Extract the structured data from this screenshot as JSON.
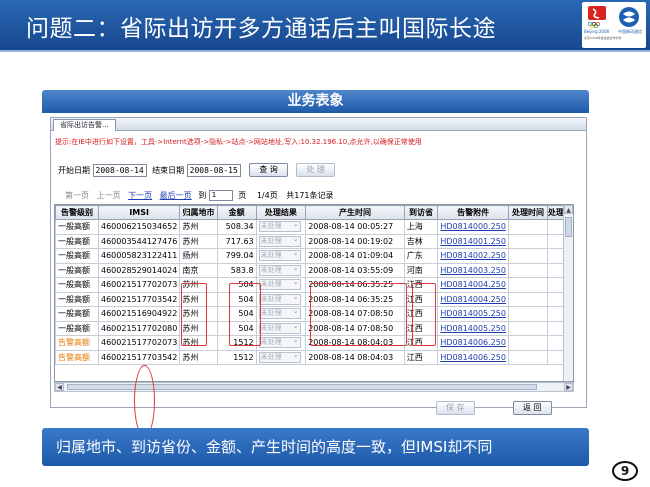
{
  "slide": {
    "title": "问题二：省际出访开多方通话后主叫国际长途",
    "caption": "归属地市、到访省份、金额、产生时间的高度一致，但IMSI却不同",
    "page_number": "9"
  },
  "logos": {
    "olympic_caption": "Beijing 2008",
    "mobile_caption": "中国移动通信",
    "note": "北京2008年奥运会合作伙伴",
    "brand_color": "#1d5fb2"
  },
  "panel": {
    "banner_title": "业务表象",
    "tab_label": "省际出访告警..."
  },
  "hint": "提示:在IE中进行如下设置，工具->Internt选项->隐私->站点->网站地址,写入:10.32.196.10,点允许,以确保正常使用",
  "filter": {
    "start_label": "开始日期",
    "start_value": "2008-08-14",
    "end_label": "结束日期",
    "end_value": "2008-08-15",
    "query_button": "查 询",
    "process_button": "处 理"
  },
  "pager": {
    "first": "第一页",
    "prev": "上一页",
    "next": "下一页",
    "last": "最后一页",
    "goto_label": "到",
    "page_value": "1",
    "page_unit": "页",
    "page_of": "1/4页",
    "total": "共171条记录"
  },
  "table": {
    "headers": [
      "告警级别",
      "IMSI",
      "归属地市",
      "金额",
      "处理结果",
      "产生时间",
      "到访省",
      "告警附件",
      "处理时间",
      "处理人"
    ],
    "rows": [
      {
        "level": "一般高额",
        "imsi": "460006215034652",
        "city": "苏州",
        "amount": "508.34",
        "result": "未处理",
        "time": "2008-08-14 00:05:27",
        "province": "上海",
        "attachment": "HD0814000.250",
        "level_color": "normal"
      },
      {
        "level": "一般高额",
        "imsi": "460003544127476",
        "city": "苏州",
        "amount": "717.63",
        "result": "未处理",
        "time": "2008-08-14 00:19:02",
        "province": "吉林",
        "attachment": "HD0814001.250",
        "level_color": "normal"
      },
      {
        "level": "一般高额",
        "imsi": "460005823122411",
        "city": "扬州",
        "amount": "799.04",
        "result": "未处理",
        "time": "2008-08-14 01:09:04",
        "province": "广东",
        "attachment": "HD0814002.250",
        "level_color": "normal"
      },
      {
        "level": "一般高额",
        "imsi": "460028529014024",
        "city": "南京",
        "amount": "583.8",
        "result": "未处理",
        "time": "2008-08-14 03:55:09",
        "province": "河南",
        "attachment": "HD0814003.250",
        "level_color": "normal"
      },
      {
        "level": "一般高额",
        "imsi": "460021517702073",
        "city": "苏州",
        "amount": "504",
        "result": "未处理",
        "time": "2008-08-14 06:35:25",
        "province": "江西",
        "attachment": "HD0814004.250",
        "level_color": "normal"
      },
      {
        "level": "一般高额",
        "imsi": "460021517703542",
        "city": "苏州",
        "amount": "504",
        "result": "未处理",
        "time": "2008-08-14 06:35:25",
        "province": "江西",
        "attachment": "HD0814004.250",
        "level_color": "normal"
      },
      {
        "level": "一般高额",
        "imsi": "460021516904922",
        "city": "苏州",
        "amount": "504",
        "result": "未处理",
        "time": "2008-08-14 07:08:50",
        "province": "江西",
        "attachment": "HD0814005.250",
        "level_color": "normal"
      },
      {
        "level": "一般高额",
        "imsi": "460021517702080",
        "city": "苏州",
        "amount": "504",
        "result": "未处理",
        "time": "2008-08-14 07:08:50",
        "province": "江西",
        "attachment": "HD0814005.250",
        "level_color": "normal"
      },
      {
        "level": "告警高额",
        "imsi": "460021517702073",
        "city": "苏州",
        "amount": "1512",
        "result": "未处理",
        "time": "2008-08-14 08:04:03",
        "province": "江西",
        "attachment": "HD0814006.250",
        "level_color": "orange"
      },
      {
        "level": "告警高额",
        "imsi": "460021517703542",
        "city": "苏州",
        "amount": "1512",
        "result": "未处理",
        "time": "2008-08-14 08:04:03",
        "province": "江西",
        "attachment": "HD0814006.250",
        "level_color": "orange"
      }
    ]
  },
  "footer": {
    "save_button": "保 存",
    "back_button": "返 回"
  },
  "colors": {
    "header_blue": "#17488f",
    "hint_red": "#d61b1b",
    "warning_orange": "#e07a00",
    "highlight_red": "#d83a3a"
  }
}
